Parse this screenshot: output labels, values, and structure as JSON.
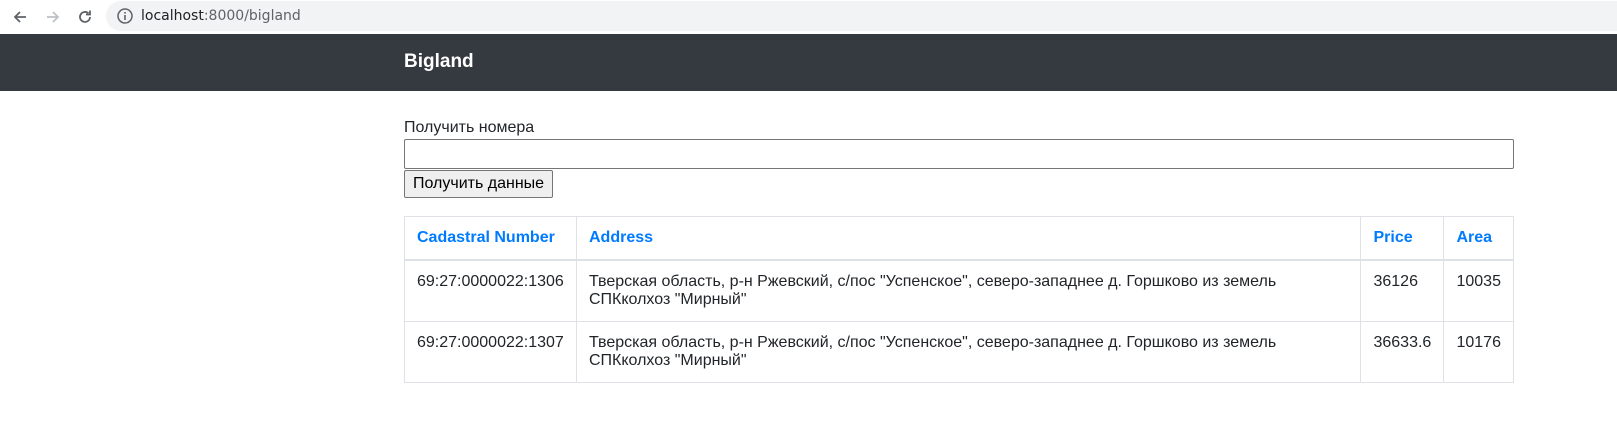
{
  "browser": {
    "url_host": "localhost",
    "url_rest": ":8000/bigland"
  },
  "navbar": {
    "brand": "Bigland"
  },
  "form": {
    "label": "Получить номера",
    "input_value": "",
    "submit_label": "Получить данные"
  },
  "table": {
    "headers": [
      "Cadastral Number",
      "Address",
      "Price",
      "Area"
    ],
    "rows": [
      {
        "cadastral_number": "69:27:0000022:1306",
        "address": "Тверская область, р-н Ржевский, с/пос \"Успенское\", северо-западнее д. Горшково из земель СПКколхоз \"Мирный\"",
        "price": "36126",
        "area": "10035"
      },
      {
        "cadastral_number": "69:27:0000022:1307",
        "address": "Тверская область, р-н Ржевский, с/пос \"Успенское\", северо-западнее д. Горшково из земель СПКколхоз \"Мирный\"",
        "price": "36633.6",
        "area": "10176"
      }
    ]
  },
  "colors": {
    "navbar_bg": "#343a40",
    "link_blue": "#007bff"
  }
}
